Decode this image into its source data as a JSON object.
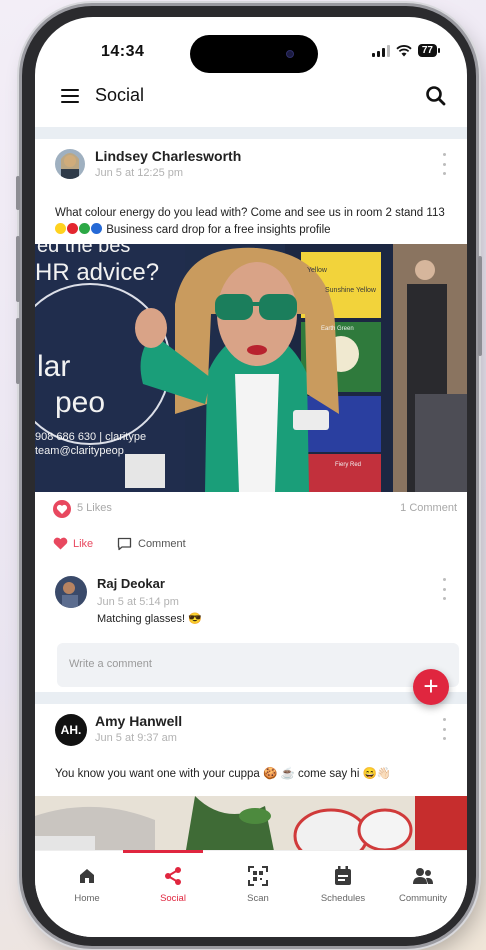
{
  "status_bar": {
    "time": "14:34",
    "battery": "77"
  },
  "app_bar": {
    "title": "Social"
  },
  "posts": [
    {
      "author": "Lindsey Charlesworth",
      "date": "Jun 5 at 12:25 pm",
      "text_before": "What colour energy do you lead with? Come and see us in room 2 stand 113",
      "text_after": "Business card drop for a free insights profile",
      "photo_text": {
        "headline": "HR advice?",
        "headline_top": "ed the bes",
        "brand_partial": "lar",
        "brand_partial2": "peo",
        "phone": "908 686 630 | claritype",
        "email": "team@claritypeop",
        "panel_title": "Sunshine Yellow",
        "panel_title2": "Earth Green",
        "panel_title3": "Fiery Red",
        "panel_small": "Yellow"
      },
      "likes": "5 Likes",
      "comments": "1 Comment",
      "like_label": "Like",
      "comment_label": "Comment"
    },
    {
      "author": "Amy Hanwell",
      "initials": "AH.",
      "date": "Jun 5 at 9:37 am",
      "text": "You know you want one with your cuppa 🍪 ☕ come say hi 😄👋🏻"
    }
  ],
  "comment": {
    "author": "Raj Deokar",
    "date": "Jun 5 at 5:14 pm",
    "text": "Matching glasses! 😎"
  },
  "write_comment": {
    "placeholder": "Write a comment"
  },
  "tabs": [
    {
      "label": "Home",
      "icon": "home-icon"
    },
    {
      "label": "Social",
      "icon": "share-icon",
      "active": true
    },
    {
      "label": "Scan",
      "icon": "qr-scan-icon"
    },
    {
      "label": "Schedules",
      "icon": "calendar-icon"
    },
    {
      "label": "Community",
      "icon": "people-icon"
    }
  ],
  "colors": {
    "accent": "#e0263f",
    "like": "#e8485f",
    "feed_bg": "#e9eef3"
  }
}
